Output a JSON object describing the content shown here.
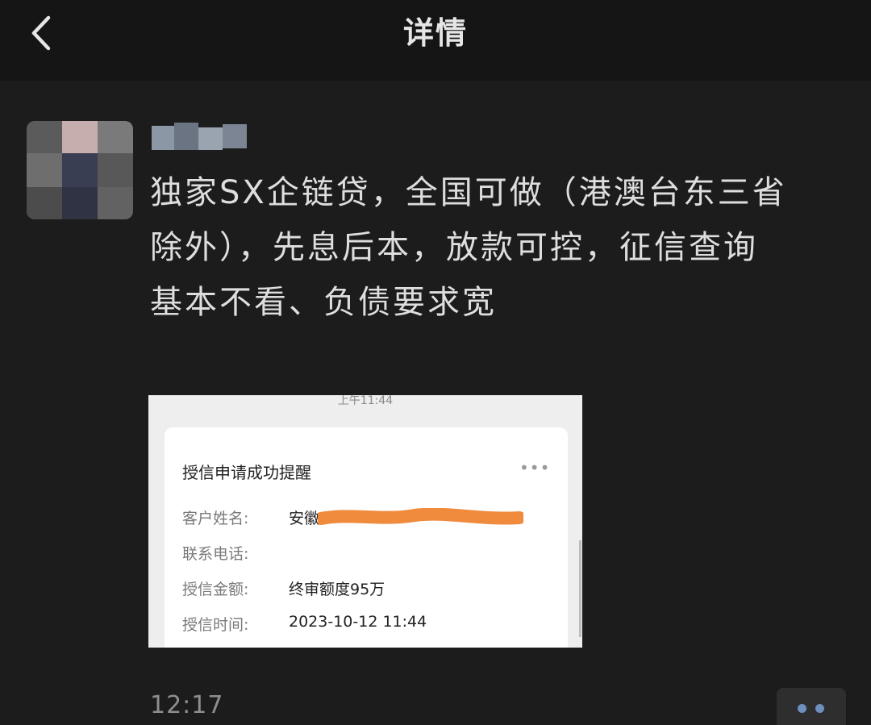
{
  "header": {
    "title": "详情",
    "back_icon": "chevron-left-icon"
  },
  "post": {
    "author_name": "",
    "text_lines": [
      "独家SX企链贷，全国可做（港澳台东三省",
      "除外），先息后本，放款可控，征信查询",
      "基本不看、负债要求宽"
    ],
    "timestamp": "12:17",
    "more_icon": "more-dots-icon"
  },
  "attachment": {
    "status_time": "上午11:44",
    "card_title": "授信申请成功提醒",
    "more_icon": "ellipsis-icon",
    "rows": [
      {
        "label": "客户姓名:",
        "value": "安徽"
      },
      {
        "label": "联系电话:",
        "value": ""
      },
      {
        "label": "授信金额:",
        "value": "终审额度95万"
      },
      {
        "label": "授信时间:",
        "value": "2023-10-12 11:44"
      }
    ],
    "redaction_color": "#f08a3c"
  },
  "colors": {
    "background": "#1c1c1c",
    "header": "#151515",
    "text": "#dedede",
    "accent": "#6f8fbf"
  }
}
